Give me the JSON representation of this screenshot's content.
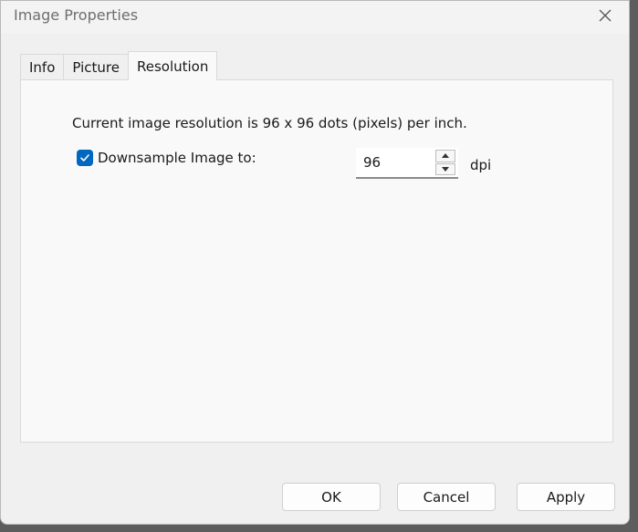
{
  "window": {
    "title": "Image Properties"
  },
  "tabs": [
    {
      "label": "Info",
      "active": false
    },
    {
      "label": "Picture",
      "active": false
    },
    {
      "label": "Resolution",
      "active": true
    }
  ],
  "resolution": {
    "current_text": "Current image resolution is 96 x 96 dots (pixels) per inch.",
    "downsample_label": "Downsample Image to:",
    "downsample_checked": true,
    "dpi_value": "96",
    "unit": "dpi"
  },
  "buttons": {
    "ok": "OK",
    "cancel": "Cancel",
    "apply": "Apply"
  },
  "colors": {
    "accent": "#0067c0",
    "window_bg": "#f0f0f0",
    "panel_bg": "#f9f9f9"
  },
  "icons": {
    "close": "close-icon",
    "check": "checkmark-icon",
    "spin_up": "chevron-up-icon",
    "spin_down": "chevron-down-icon"
  }
}
